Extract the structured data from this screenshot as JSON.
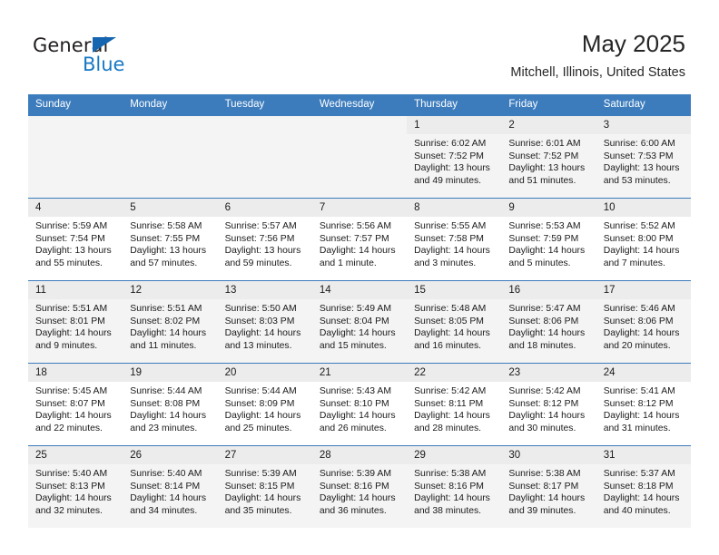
{
  "brand": {
    "name_part1": "General",
    "name_part2": "Blue",
    "triangle_icon": "triangle-icon",
    "colors": {
      "text": "#231f20",
      "blue": "#1778c4",
      "triangle": "#1565b0"
    }
  },
  "header": {
    "title": "May 2025",
    "subtitle": "Mitchell, Illinois, United States"
  },
  "theme": {
    "header_row_bg": "#3c7cbd",
    "header_row_text": "#ffffff",
    "daynum_band_bg": "#ececec",
    "alt_row_bg": "#f4f4f4",
    "row_border": "#3c7cbd"
  },
  "weekdays": [
    "Sunday",
    "Monday",
    "Tuesday",
    "Wednesday",
    "Thursday",
    "Friday",
    "Saturday"
  ],
  "labels": {
    "sunrise_prefix": "Sunrise:",
    "sunset_prefix": "Sunset:",
    "daylight_prefix": "Daylight:"
  },
  "weeks": [
    {
      "shaded": true,
      "days": [
        {
          "empty": true
        },
        {
          "empty": true
        },
        {
          "empty": true
        },
        {
          "empty": true
        },
        {
          "day": "1",
          "sunrise": "Sunrise: 6:02 AM",
          "sunset": "Sunset: 7:52 PM",
          "daylight_line1": "Daylight: 13 hours",
          "daylight_line2": "and 49 minutes."
        },
        {
          "day": "2",
          "sunrise": "Sunrise: 6:01 AM",
          "sunset": "Sunset: 7:52 PM",
          "daylight_line1": "Daylight: 13 hours",
          "daylight_line2": "and 51 minutes."
        },
        {
          "day": "3",
          "sunrise": "Sunrise: 6:00 AM",
          "sunset": "Sunset: 7:53 PM",
          "daylight_line1": "Daylight: 13 hours",
          "daylight_line2": "and 53 minutes."
        }
      ]
    },
    {
      "shaded": false,
      "days": [
        {
          "day": "4",
          "sunrise": "Sunrise: 5:59 AM",
          "sunset": "Sunset: 7:54 PM",
          "daylight_line1": "Daylight: 13 hours",
          "daylight_line2": "and 55 minutes."
        },
        {
          "day": "5",
          "sunrise": "Sunrise: 5:58 AM",
          "sunset": "Sunset: 7:55 PM",
          "daylight_line1": "Daylight: 13 hours",
          "daylight_line2": "and 57 minutes."
        },
        {
          "day": "6",
          "sunrise": "Sunrise: 5:57 AM",
          "sunset": "Sunset: 7:56 PM",
          "daylight_line1": "Daylight: 13 hours",
          "daylight_line2": "and 59 minutes."
        },
        {
          "day": "7",
          "sunrise": "Sunrise: 5:56 AM",
          "sunset": "Sunset: 7:57 PM",
          "daylight_line1": "Daylight: 14 hours",
          "daylight_line2": "and 1 minute."
        },
        {
          "day": "8",
          "sunrise": "Sunrise: 5:55 AM",
          "sunset": "Sunset: 7:58 PM",
          "daylight_line1": "Daylight: 14 hours",
          "daylight_line2": "and 3 minutes."
        },
        {
          "day": "9",
          "sunrise": "Sunrise: 5:53 AM",
          "sunset": "Sunset: 7:59 PM",
          "daylight_line1": "Daylight: 14 hours",
          "daylight_line2": "and 5 minutes."
        },
        {
          "day": "10",
          "sunrise": "Sunrise: 5:52 AM",
          "sunset": "Sunset: 8:00 PM",
          "daylight_line1": "Daylight: 14 hours",
          "daylight_line2": "and 7 minutes."
        }
      ]
    },
    {
      "shaded": true,
      "days": [
        {
          "day": "11",
          "sunrise": "Sunrise: 5:51 AM",
          "sunset": "Sunset: 8:01 PM",
          "daylight_line1": "Daylight: 14 hours",
          "daylight_line2": "and 9 minutes."
        },
        {
          "day": "12",
          "sunrise": "Sunrise: 5:51 AM",
          "sunset": "Sunset: 8:02 PM",
          "daylight_line1": "Daylight: 14 hours",
          "daylight_line2": "and 11 minutes."
        },
        {
          "day": "13",
          "sunrise": "Sunrise: 5:50 AM",
          "sunset": "Sunset: 8:03 PM",
          "daylight_line1": "Daylight: 14 hours",
          "daylight_line2": "and 13 minutes."
        },
        {
          "day": "14",
          "sunrise": "Sunrise: 5:49 AM",
          "sunset": "Sunset: 8:04 PM",
          "daylight_line1": "Daylight: 14 hours",
          "daylight_line2": "and 15 minutes."
        },
        {
          "day": "15",
          "sunrise": "Sunrise: 5:48 AM",
          "sunset": "Sunset: 8:05 PM",
          "daylight_line1": "Daylight: 14 hours",
          "daylight_line2": "and 16 minutes."
        },
        {
          "day": "16",
          "sunrise": "Sunrise: 5:47 AM",
          "sunset": "Sunset: 8:06 PM",
          "daylight_line1": "Daylight: 14 hours",
          "daylight_line2": "and 18 minutes."
        },
        {
          "day": "17",
          "sunrise": "Sunrise: 5:46 AM",
          "sunset": "Sunset: 8:06 PM",
          "daylight_line1": "Daylight: 14 hours",
          "daylight_line2": "and 20 minutes."
        }
      ]
    },
    {
      "shaded": false,
      "days": [
        {
          "day": "18",
          "sunrise": "Sunrise: 5:45 AM",
          "sunset": "Sunset: 8:07 PM",
          "daylight_line1": "Daylight: 14 hours",
          "daylight_line2": "and 22 minutes."
        },
        {
          "day": "19",
          "sunrise": "Sunrise: 5:44 AM",
          "sunset": "Sunset: 8:08 PM",
          "daylight_line1": "Daylight: 14 hours",
          "daylight_line2": "and 23 minutes."
        },
        {
          "day": "20",
          "sunrise": "Sunrise: 5:44 AM",
          "sunset": "Sunset: 8:09 PM",
          "daylight_line1": "Daylight: 14 hours",
          "daylight_line2": "and 25 minutes."
        },
        {
          "day": "21",
          "sunrise": "Sunrise: 5:43 AM",
          "sunset": "Sunset: 8:10 PM",
          "daylight_line1": "Daylight: 14 hours",
          "daylight_line2": "and 26 minutes."
        },
        {
          "day": "22",
          "sunrise": "Sunrise: 5:42 AM",
          "sunset": "Sunset: 8:11 PM",
          "daylight_line1": "Daylight: 14 hours",
          "daylight_line2": "and 28 minutes."
        },
        {
          "day": "23",
          "sunrise": "Sunrise: 5:42 AM",
          "sunset": "Sunset: 8:12 PM",
          "daylight_line1": "Daylight: 14 hours",
          "daylight_line2": "and 30 minutes."
        },
        {
          "day": "24",
          "sunrise": "Sunrise: 5:41 AM",
          "sunset": "Sunset: 8:12 PM",
          "daylight_line1": "Daylight: 14 hours",
          "daylight_line2": "and 31 minutes."
        }
      ]
    },
    {
      "shaded": true,
      "days": [
        {
          "day": "25",
          "sunrise": "Sunrise: 5:40 AM",
          "sunset": "Sunset: 8:13 PM",
          "daylight_line1": "Daylight: 14 hours",
          "daylight_line2": "and 32 minutes."
        },
        {
          "day": "26",
          "sunrise": "Sunrise: 5:40 AM",
          "sunset": "Sunset: 8:14 PM",
          "daylight_line1": "Daylight: 14 hours",
          "daylight_line2": "and 34 minutes."
        },
        {
          "day": "27",
          "sunrise": "Sunrise: 5:39 AM",
          "sunset": "Sunset: 8:15 PM",
          "daylight_line1": "Daylight: 14 hours",
          "daylight_line2": "and 35 minutes."
        },
        {
          "day": "28",
          "sunrise": "Sunrise: 5:39 AM",
          "sunset": "Sunset: 8:16 PM",
          "daylight_line1": "Daylight: 14 hours",
          "daylight_line2": "and 36 minutes."
        },
        {
          "day": "29",
          "sunrise": "Sunrise: 5:38 AM",
          "sunset": "Sunset: 8:16 PM",
          "daylight_line1": "Daylight: 14 hours",
          "daylight_line2": "and 38 minutes."
        },
        {
          "day": "30",
          "sunrise": "Sunrise: 5:38 AM",
          "sunset": "Sunset: 8:17 PM",
          "daylight_line1": "Daylight: 14 hours",
          "daylight_line2": "and 39 minutes."
        },
        {
          "day": "31",
          "sunrise": "Sunrise: 5:37 AM",
          "sunset": "Sunset: 8:18 PM",
          "daylight_line1": "Daylight: 14 hours",
          "daylight_line2": "and 40 minutes."
        }
      ]
    }
  ]
}
